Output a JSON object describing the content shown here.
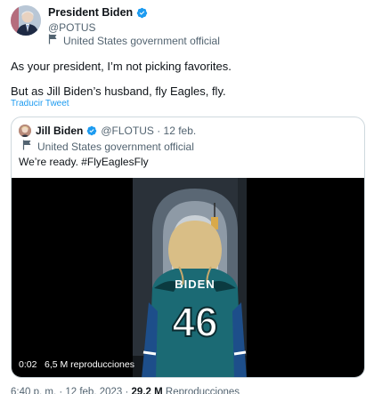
{
  "tweet": {
    "author_name": "President Biden",
    "author_handle": "@POTUS",
    "gov_label": "United States government official",
    "line1": "As your president, I’m not picking favorites.",
    "line2": "But as Jill Biden’s husband, fly Eagles, fly.",
    "translate_label": "Traducir Tweet"
  },
  "quote": {
    "author_name": "Jill Biden",
    "handle_date": "@FLOTUS · 12 feb.",
    "gov_label": "United States government official",
    "text": "We’re ready. #FlyEaglesFly",
    "video": {
      "jersey_name": "BIDEN",
      "jersey_number": "46",
      "duration": "0:02",
      "views": "6,5 M reproducciones"
    }
  },
  "footer": {
    "time_date": "6:40 p. m. · 12 feb. 2023 · ",
    "views_count": "29,2 M",
    "views_label": " Reproducciones"
  },
  "colors": {
    "verified": "#1d9bf0",
    "link": "#1d9bf0",
    "jersey": "#1b6a74"
  },
  "icons": [
    "verified-badge-icon",
    "government-flag-icon"
  ]
}
